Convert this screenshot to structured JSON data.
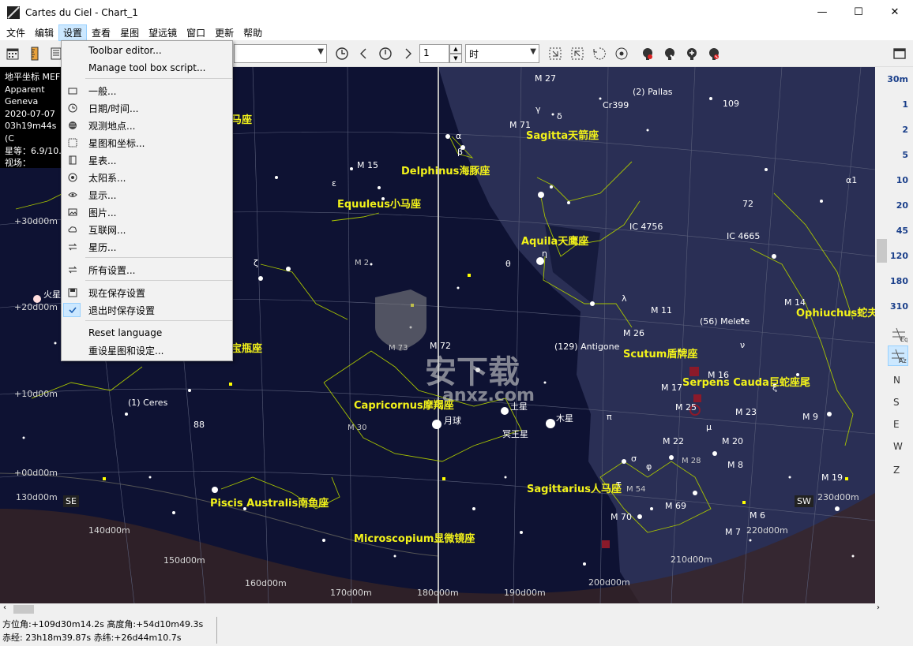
{
  "window": {
    "title": "Cartes du Ciel - Chart_1",
    "minimize": "—",
    "maximize": "☐",
    "close": "✕"
  },
  "menubar": {
    "items": [
      "文件",
      "编辑",
      "设置",
      "查看",
      "星图",
      "望远镜",
      "窗口",
      "更新",
      "帮助"
    ],
    "active": "设置"
  },
  "toolbar": {
    "time_step_value": "1",
    "time_unit": "时"
  },
  "settings_menu": {
    "items": [
      {
        "label": "Toolbar editor...",
        "icon": "none"
      },
      {
        "label": "Manage tool box script...",
        "icon": "none"
      },
      {
        "label": "一般...",
        "icon": "window-icon"
      },
      {
        "label": "日期/时间...",
        "icon": "clock-icon"
      },
      {
        "label": "观测地点...",
        "icon": "globe-icon"
      },
      {
        "label": "星图和坐标...",
        "icon": "grid-icon"
      },
      {
        "label": "星表...",
        "icon": "catalog-icon"
      },
      {
        "label": "太阳系...",
        "icon": "target-icon"
      },
      {
        "label": "显示...",
        "icon": "eye-icon"
      },
      {
        "label": "图片...",
        "icon": "image-icon"
      },
      {
        "label": "互联网...",
        "icon": "cloud-icon"
      },
      {
        "label": "星历...",
        "icon": "swap-icon"
      },
      {
        "label": "所有设置...",
        "icon": "swap-icon"
      },
      {
        "label": "现在保存设置",
        "icon": "save-icon"
      },
      {
        "label": "退出时保存设置",
        "icon": "check-icon"
      },
      {
        "label": "Reset language",
        "icon": "none"
      },
      {
        "label": "重设星图和设定...",
        "icon": "none"
      }
    ]
  },
  "info_panel": {
    "lines": [
      "地平坐标 MEF",
      "Apparent",
      "Geneva",
      "2020-07-07",
      "03h19m44s (C",
      "星等：6.9/10.",
      "视场：+120d0"
    ]
  },
  "chart": {
    "constellations": [
      {
        "label": "Sagitta天箭座"
      },
      {
        "label": "Delphinus海豚座"
      },
      {
        "label": "Equuleus小马座"
      },
      {
        "label": "Aquila天鹰座"
      },
      {
        "label": "Ophiuchus蛇夫"
      },
      {
        "label": "Scutum盾牌座"
      },
      {
        "label": "Serpens Cauda巨蛇座尾"
      },
      {
        "label": "Capricornus摩羯座"
      },
      {
        "label": "Sagittarius人马座"
      },
      {
        "label": "Piscis Australis南鱼座"
      },
      {
        "label": "Microscopium显微镜座"
      },
      {
        "label": "宝瓶座"
      },
      {
        "label": "马座"
      }
    ],
    "objects": [
      {
        "label": "M 27"
      },
      {
        "label": "(2) Pallas"
      },
      {
        "label": "Cr399"
      },
      {
        "label": "M 71"
      },
      {
        "label": "M 15"
      },
      {
        "label": "IC 4756"
      },
      {
        "label": "IC 4665"
      },
      {
        "label": "M 11"
      },
      {
        "label": "(56) Melete"
      },
      {
        "label": "M 26"
      },
      {
        "label": "M 14"
      },
      {
        "label": "(129) Antigone"
      },
      {
        "label": "M 16"
      },
      {
        "label": "M 17"
      },
      {
        "label": "M 25"
      },
      {
        "label": "M 23"
      },
      {
        "label": "M 9"
      },
      {
        "label": "(1) Ceres"
      },
      {
        "label": "月球"
      },
      {
        "label": "土星"
      },
      {
        "label": "木星"
      },
      {
        "label": "冥王星"
      },
      {
        "label": "M 22"
      },
      {
        "label": "M 20"
      },
      {
        "label": "M 8"
      },
      {
        "label": "M 19"
      },
      {
        "label": "M 69"
      },
      {
        "label": "M 70"
      },
      {
        "label": "M 6"
      },
      {
        "label": "M 7"
      },
      {
        "label": "火星"
      },
      {
        "label": "M 30"
      },
      {
        "label": "M 2"
      },
      {
        "label": "M 73"
      },
      {
        "label": "M 72"
      },
      {
        "label": "M 28"
      },
      {
        "label": "M 54"
      }
    ],
    "declinations": [
      "+30d00m",
      "+20d00m",
      "+10d00m",
      "+00d00m"
    ],
    "azimuths": [
      "130d00m",
      "140d00m",
      "150d00m",
      "160d00m",
      "170d00m",
      "180d00m",
      "190d00m",
      "200d00m",
      "210d00m",
      "220d00m",
      "230d00m"
    ],
    "cardinals": {
      "se": "SE",
      "sw": "SW"
    },
    "greek": [
      "α",
      "β",
      "γ",
      "δ",
      "ε",
      "ζ",
      "η",
      "θ",
      "λ",
      "ν",
      "ξ",
      "π",
      "σ",
      "φ",
      "μ",
      "τ",
      "α1",
      "72",
      "109",
      "88"
    ]
  },
  "right_panel": {
    "zoom": [
      "30m",
      "1",
      "2",
      "5",
      "10",
      "20",
      "45",
      "120",
      "180",
      "310"
    ],
    "directions": [
      "N",
      "S",
      "E",
      "W",
      "Z"
    ]
  },
  "status": {
    "line1": "方位角:+109d30m14.2s 高度角:+54d10m49.3s",
    "line2": "赤经: 23h18m39.87s 赤纬:+26d44m10.7s"
  },
  "colors": {
    "sky": "#0e1233",
    "milky_way": "#2a2f55",
    "constellation_label": "#f2f21a",
    "constellation_line": "#a8c400",
    "ground": "#3a2626",
    "zoom_text": "#1a3f8a",
    "menu_highlight": "#cce8ff"
  },
  "watermark": {
    "text": "安下载",
    "sub": "anxz.com"
  }
}
